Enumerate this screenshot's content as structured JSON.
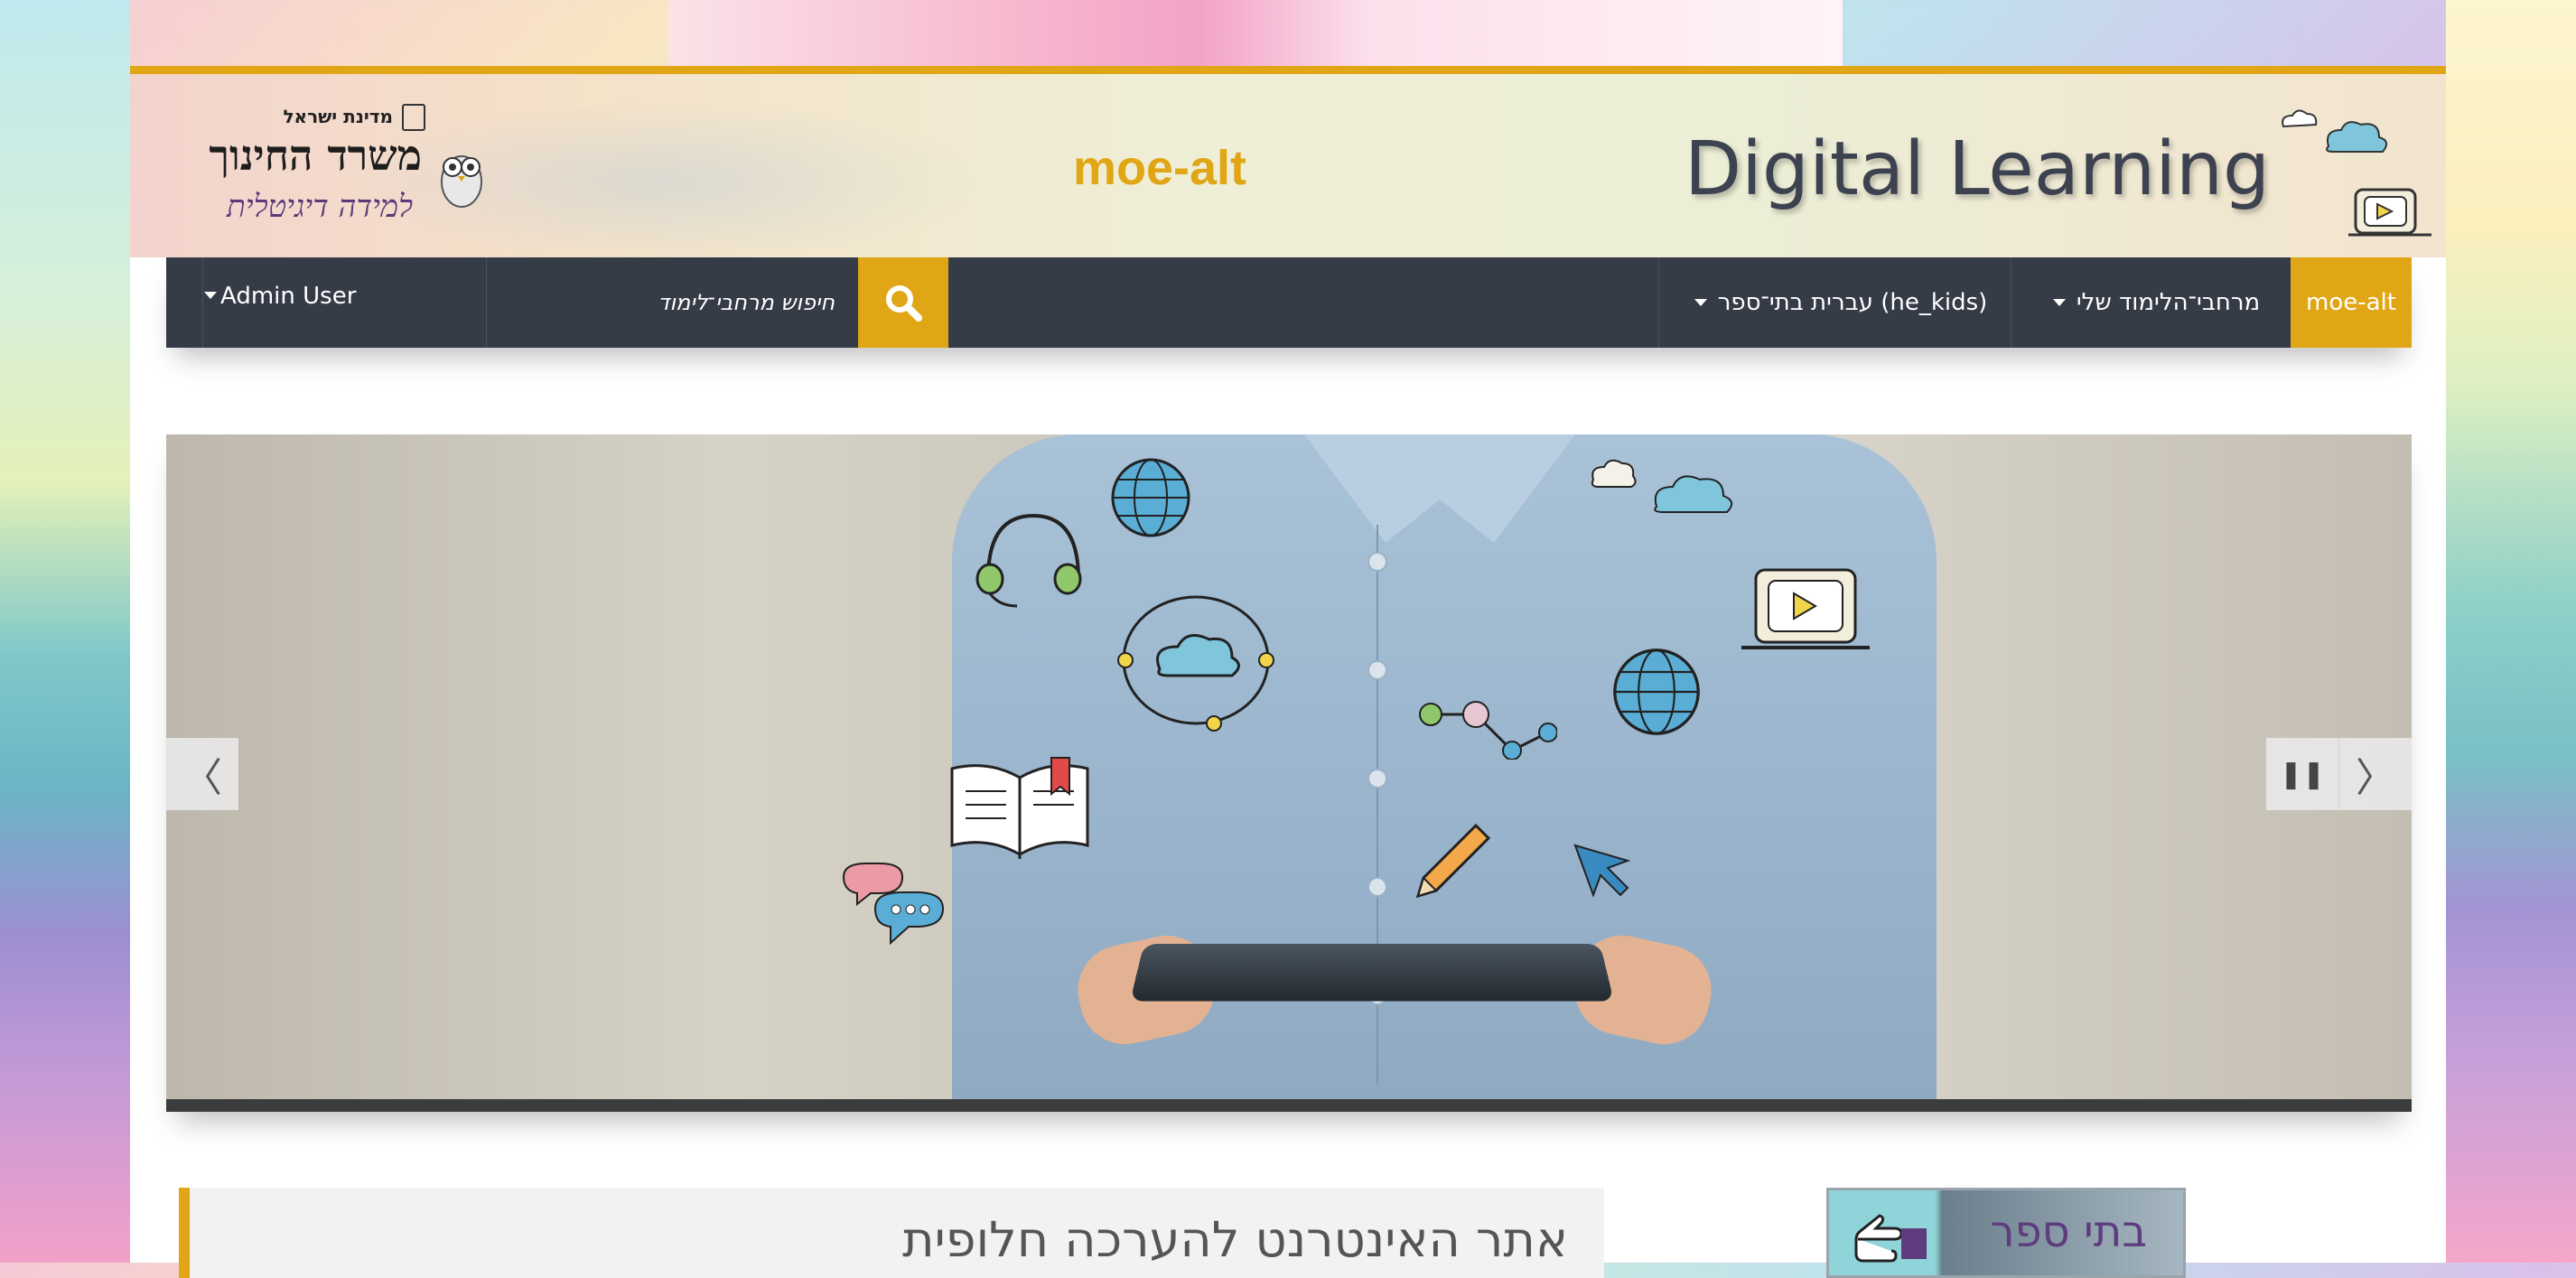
{
  "header": {
    "gov_label": "מדינת ישראל",
    "ministry_title": "משרד החינוך",
    "ministry_subtitle": "למידה דיגיטלית",
    "site_title": "moe-alt",
    "brand_title": "Digital Learning"
  },
  "nav": {
    "home_label": "moe-alt",
    "my_spaces_label": "מרחבי־הלימוד שלי",
    "language_label": "עברית בתי־ספר (he_kids)",
    "search_placeholder": "חיפוש מרחבי־לימוד",
    "user_label": "Admin User"
  },
  "slider": {
    "prev_symbol": "〈",
    "next_symbol": "〉",
    "pause_symbol": "❚❚"
  },
  "content": {
    "section_title": "אתר האינטרנט להערכה חלופית",
    "schools_label": "בתי ספר"
  },
  "colors": {
    "accent": "#e0a615",
    "nav_bg": "#353b47",
    "title_text": "#3d4250"
  },
  "icons": [
    "search-icon",
    "caret-down-icon",
    "chevron-left-icon",
    "chevron-right-icon",
    "pause-icon",
    "owl-icon",
    "gov-emblem-icon",
    "pointing-hand-icon"
  ]
}
